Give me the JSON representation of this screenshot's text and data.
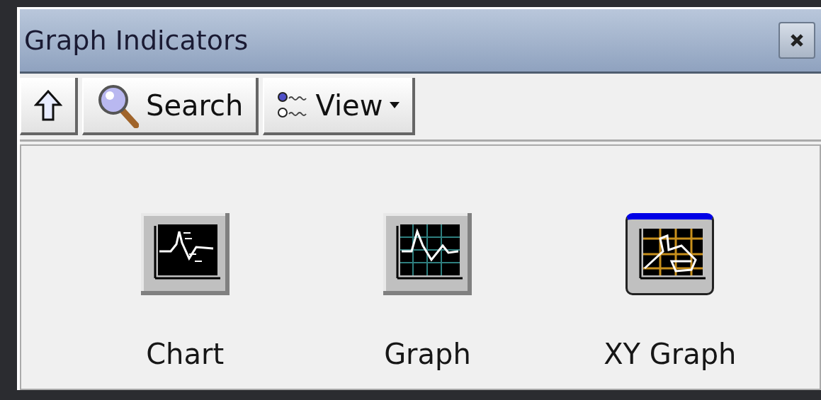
{
  "window": {
    "title": "Graph Indicators"
  },
  "toolbar": {
    "buttons": [
      {
        "kind": "up"
      },
      {
        "kind": "search",
        "label": "Search"
      },
      {
        "kind": "view",
        "label": "View"
      }
    ]
  },
  "items": [
    {
      "kind": "chart",
      "label": "Chart",
      "selected": false
    },
    {
      "kind": "graph",
      "label": "Graph",
      "selected": false
    },
    {
      "kind": "xy",
      "label": "XY Graph",
      "selected": true
    }
  ]
}
